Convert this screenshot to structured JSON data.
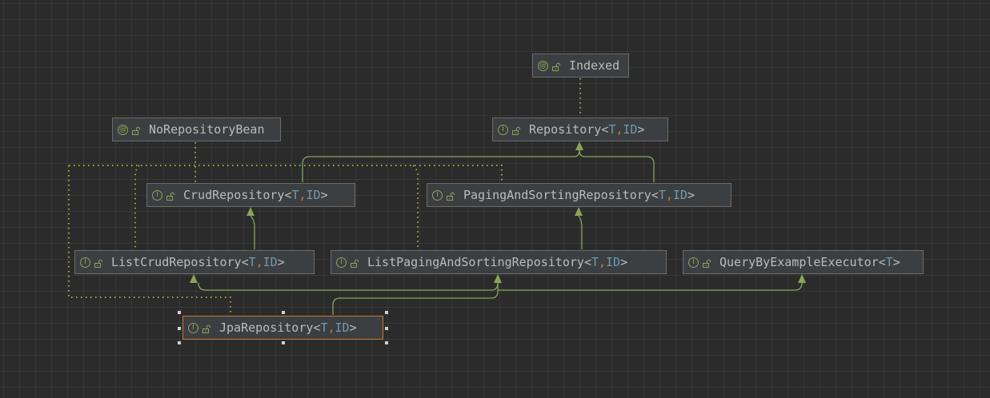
{
  "colors": {
    "background": "#2b2b2b",
    "node_fill": "#3c3f41",
    "node_border": "#6b6b6b",
    "selected_border": "#c97a2b",
    "extends_edge": "#8aa35a",
    "annotation_edge": "#a6a64a",
    "type_param": "#6f9aaf",
    "comma": "#cc7832",
    "text": "#bbbbbb"
  },
  "nodes": {
    "indexed": {
      "icon": "annotation-icon",
      "glyph": "@",
      "name": "Indexed",
      "params": []
    },
    "no_repository_bean": {
      "icon": "annotation-icon",
      "glyph": "@",
      "name": "NoRepositoryBean",
      "params": []
    },
    "repository": {
      "icon": "interface-icon",
      "glyph": "I",
      "name": "Repository",
      "params": [
        "T",
        "ID"
      ]
    },
    "crud_repository": {
      "icon": "interface-icon",
      "glyph": "I",
      "name": "CrudRepository",
      "params": [
        "T",
        "ID"
      ]
    },
    "paging_and_sorting_repository": {
      "icon": "interface-icon",
      "glyph": "I",
      "name": "PagingAndSortingRepository",
      "params": [
        "T",
        "ID"
      ]
    },
    "list_crud_repository": {
      "icon": "interface-icon",
      "glyph": "I",
      "name": "ListCrudRepository",
      "params": [
        "T",
        "ID"
      ]
    },
    "list_paging_and_sorting_repository": {
      "icon": "interface-icon",
      "glyph": "I",
      "name": "ListPagingAndSortingRepository",
      "params": [
        "T",
        "ID"
      ]
    },
    "query_by_example_executor": {
      "icon": "interface-icon",
      "glyph": "I",
      "name": "QueryByExampleExecutor",
      "params": [
        "T"
      ]
    },
    "jpa_repository": {
      "icon": "interface-icon",
      "glyph": "I",
      "name": "JpaRepository",
      "params": [
        "T",
        "ID"
      ],
      "selected": true
    }
  },
  "edges": [
    {
      "from": "repository",
      "to": "indexed",
      "kind": "annotated"
    },
    {
      "from": "crud_repository",
      "to": "repository",
      "kind": "extends"
    },
    {
      "from": "paging_and_sorting_repository",
      "to": "repository",
      "kind": "extends"
    },
    {
      "from": "list_crud_repository",
      "to": "crud_repository",
      "kind": "extends"
    },
    {
      "from": "list_paging_and_sorting_repository",
      "to": "paging_and_sorting_repository",
      "kind": "extends"
    },
    {
      "from": "jpa_repository",
      "to": "list_crud_repository",
      "kind": "extends"
    },
    {
      "from": "jpa_repository",
      "to": "list_paging_and_sorting_repository",
      "kind": "extends"
    },
    {
      "from": "jpa_repository",
      "to": "query_by_example_executor",
      "kind": "extends"
    },
    {
      "from": "crud_repository",
      "to": "no_repository_bean",
      "kind": "annotated"
    },
    {
      "from": "paging_and_sorting_repository",
      "to": "no_repository_bean",
      "kind": "annotated"
    },
    {
      "from": "list_crud_repository",
      "to": "no_repository_bean",
      "kind": "annotated"
    },
    {
      "from": "list_paging_and_sorting_repository",
      "to": "no_repository_bean",
      "kind": "annotated"
    },
    {
      "from": "jpa_repository",
      "to": "no_repository_bean",
      "kind": "annotated"
    }
  ]
}
